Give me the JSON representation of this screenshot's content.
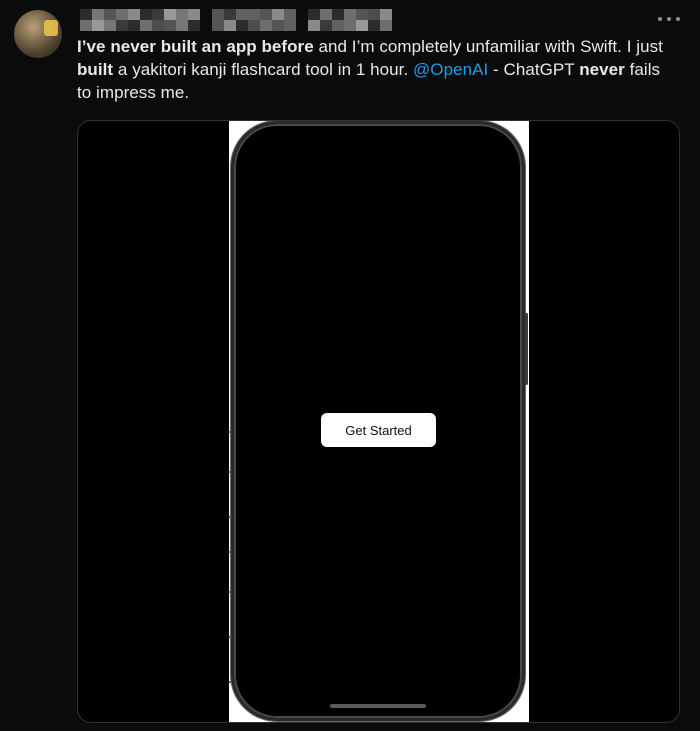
{
  "tweet": {
    "author_name": "",
    "text": {
      "seg1_bold": "I’ve never built an app before",
      "seg2": " and I’m completely unfamiliar with Swift. I just ",
      "seg3_bold": "built",
      "seg4": " a yakitori kanji flashcard tool in 1 hour.  ",
      "mention": "@OpenAI",
      "seg5": " - ChatGPT ",
      "seg6_bold": "never",
      "seg7": " fails to impress me."
    },
    "more_icon": "more-horizontal-icon"
  },
  "media": {
    "app_button_label": "Get Started"
  },
  "colors": {
    "background": "#0b0b0b",
    "text": "#e7e9ea",
    "mention": "#1d9bf0",
    "media_border": "#2f3336"
  }
}
